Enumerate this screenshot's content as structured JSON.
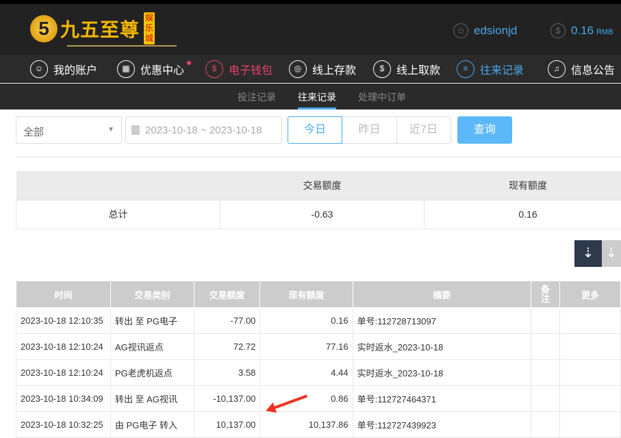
{
  "header": {
    "logo_text": "九五至尊",
    "logo_badge": "娱乐城",
    "logo_mark": "5",
    "username": "edsionjd",
    "balance": "0.16",
    "currency": "RMB"
  },
  "nav": [
    {
      "label": "我的账户"
    },
    {
      "label": "优惠中心"
    },
    {
      "label": "电子钱包"
    },
    {
      "label": "线上存款"
    },
    {
      "label": "线上取款"
    },
    {
      "label": "往来记录"
    },
    {
      "label": "信息公告"
    }
  ],
  "subnav": [
    {
      "label": "投注记录"
    },
    {
      "label": "往来记录"
    },
    {
      "label": "处理中订单"
    }
  ],
  "filters": {
    "type": "全部",
    "date_range": "2023-10-18 ~ 2023-10-18",
    "today": "今日",
    "yesterday": "昨日",
    "last7": "近7日",
    "query": "查询"
  },
  "summary": {
    "headers": [
      "",
      "交易额度",
      "现有额度"
    ],
    "label": "总计",
    "amount": "-0.63",
    "balance": "0.16"
  },
  "table": {
    "headers": [
      "时间",
      "交易类别",
      "交易额度",
      "现有额度",
      "摘要",
      "备注",
      "更多"
    ],
    "rows": [
      [
        "2023-10-18 12:10:35",
        "转出 至 PG电子",
        "-77.00",
        "0.16",
        "单号:112728713097",
        "",
        ""
      ],
      [
        "2023-10-18 12:10:24",
        "AG视讯返点",
        "72.72",
        "77.16",
        "实时返水_2023-10-18",
        "",
        ""
      ],
      [
        "2023-10-18 12:10:24",
        "PG老虎机返点",
        "3.58",
        "4.44",
        "实时返水_2023-10-18",
        "",
        ""
      ],
      [
        "2023-10-18 10:34:09",
        "转出 至 AG视讯",
        "-10,137.00",
        "0.86",
        "单号:112727464371",
        "",
        ""
      ],
      [
        "2023-10-18 10:32:25",
        "由 PG电子 转入",
        "10,137.00",
        "10,137.86",
        "单号:112727439923",
        "",
        ""
      ]
    ]
  }
}
